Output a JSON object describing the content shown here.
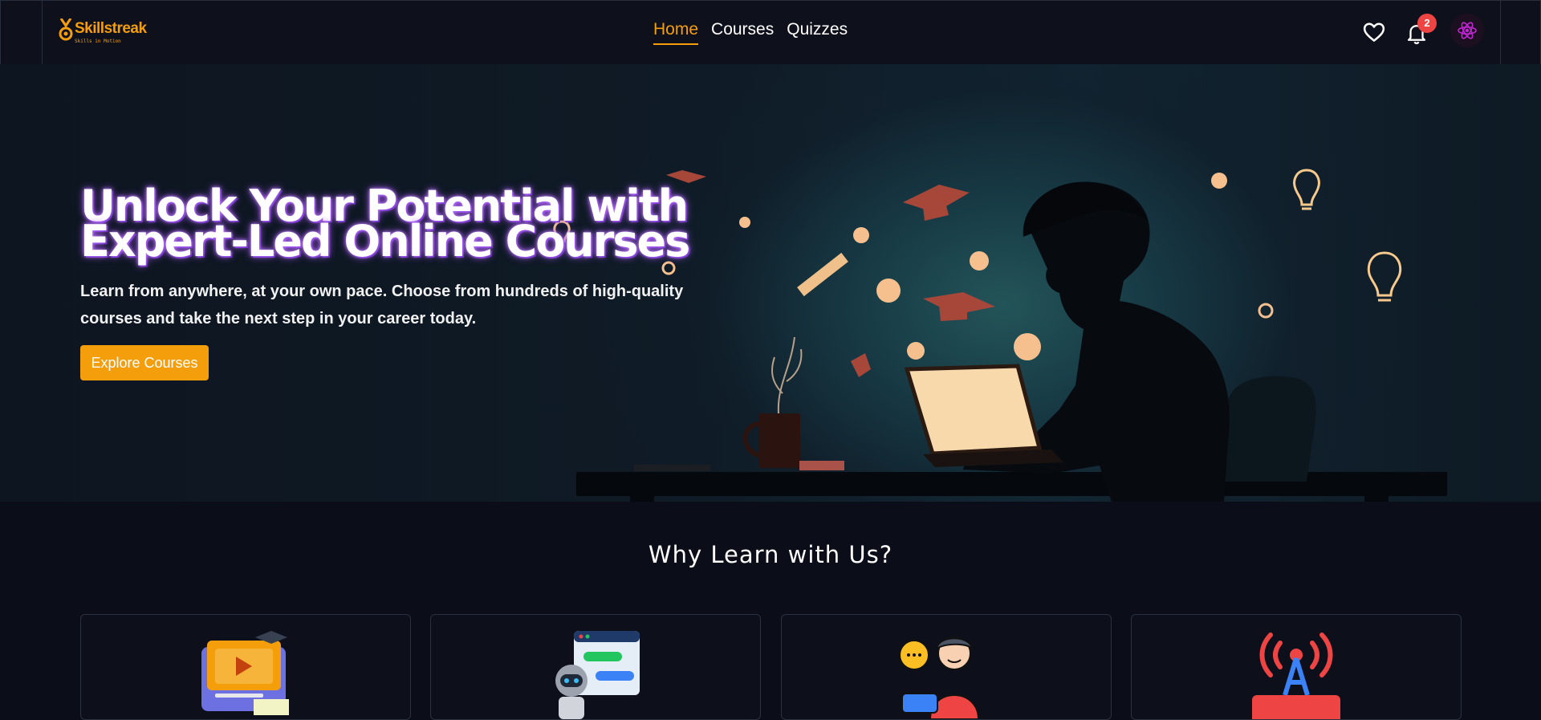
{
  "nav": {
    "logo": {
      "name": "Skillstreak",
      "tagline": "Skills in Motion"
    },
    "links": [
      {
        "label": "Home",
        "active": true
      },
      {
        "label": "Courses",
        "active": false
      },
      {
        "label": "Quizzes",
        "active": false
      }
    ],
    "icons": [
      "heart-icon",
      "bell-icon",
      "react-avatar-icon"
    ],
    "notification_count": "2"
  },
  "hero": {
    "title": "Unlock Your Potential with Expert-Led Online Courses",
    "subtitle": "Learn from anywhere, at your own pace. Choose from hundreds of high-quality courses and take the next step in your career today.",
    "cta_label": "Explore Courses"
  },
  "features": {
    "title": "Why Learn with Us?",
    "cards": [
      {
        "icon": "video-course-icon"
      },
      {
        "icon": "chatbot-icon"
      },
      {
        "icon": "mentor-chat-icon"
      },
      {
        "icon": "live-broadcast-icon"
      }
    ]
  },
  "colors": {
    "accent": "#f59e0b",
    "badge": "#ef4444",
    "background": "#0b0d18",
    "nav_bg": "#0e111c"
  }
}
